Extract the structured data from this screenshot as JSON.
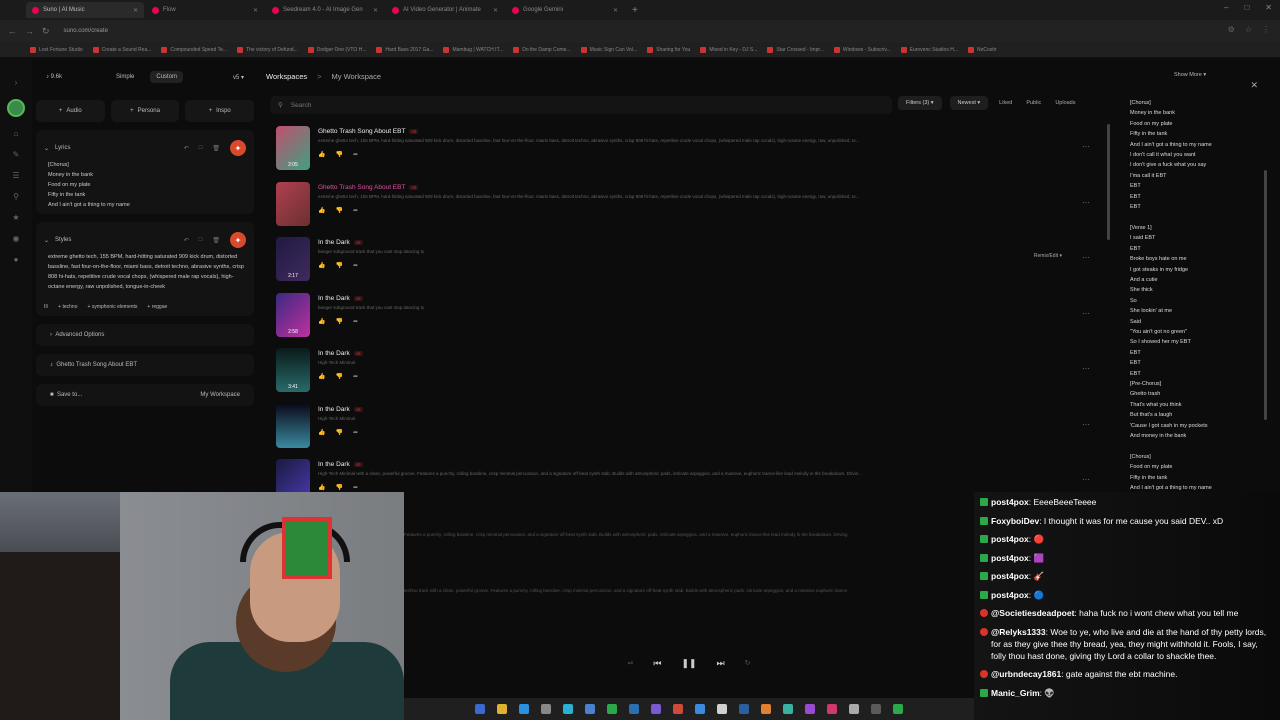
{
  "browser": {
    "tabs": [
      {
        "label": "Suno | AI Music",
        "active": true
      },
      {
        "label": "Flow",
        "active": false
      },
      {
        "label": "Seedream 4.0 - AI Image Gen",
        "active": false
      },
      {
        "label": "AI Video Generator | Animate",
        "active": false
      },
      {
        "label": "Google Gemini",
        "active": false
      }
    ],
    "url": "suno.com/create",
    "bookmarks": [
      "Lost Fortune Studio",
      "Create a Sound Rea...",
      "Compounded Speed Te...",
      "The victory of Defund...",
      "Dodger One (VTO H...",
      "Hard Bass 2017 Ga...",
      "Mambug | WATCH IT...",
      "Do the Damp Come...",
      "Music Sign Can Vol...",
      "Sharing for You",
      "Mixed in Key - DJ S...",
      "Star Crossed - Impr...",
      "Windows - Subscriv...",
      "Eurovenc Studios H...",
      "NoCostir"
    ]
  },
  "left": {
    "credits": "9.6k",
    "modes": [
      "Simple",
      "Custom"
    ],
    "version": "v5",
    "buttons": [
      "Audio",
      "Persona",
      "Inspo"
    ],
    "lyrics_label": "Lyrics",
    "lyrics": "[Chorus]\nMoney in the bank\nFood on my plate\nFifty in the tank\nAnd I ain't got a thing to my name",
    "styles_label": "Styles",
    "styles": "extreme ghetto tech, 155 BPM, hard-hitting saturated 909 kick drum, distorted bassline, fast four-on-the-floor, miami bass, detroit techno, abrasive synths, crisp 808 hi-hats, repetitive crude vocal chops, (whispered male rap vocals), high-octane energy, raw unpolished, tongue-in-cheek",
    "chips": [
      "techno",
      "symphonic elements",
      "reggae"
    ],
    "advanced": "Advanced Options",
    "song_title": "Ghetto Trash Song About EBT",
    "save_to": "Save to...",
    "workspace_btn": "My Workspace"
  },
  "workspace": {
    "root": "Workspaces",
    "current": "My Workspace",
    "search_placeholder": "Search",
    "filters": "Filters (3)",
    "sort": "Newest",
    "tabs": [
      "Liked",
      "Public",
      "Uploads"
    ],
    "remix": "Remix/Edit",
    "songs": [
      {
        "title": "Ghetto Trash Song About EBT",
        "ver": "v5",
        "desc": "extreme ghetto tech, 155 BPM, hard-hitting saturated 909 kick drum, distorted bassline, fast four-on-the-floor, miami bass, detroit techno, abrasive synths, crisp 808 hi-hats, repetitive crude vocal chops, (whispered male rap vocals), high-octane energy, raw, unpolished, to...",
        "dur": "2:05",
        "pink": false
      },
      {
        "title": "Ghetto Trash Song About EBT",
        "ver": "v5",
        "desc": "extreme ghetto tech, 155 BPM, hard-hitting saturated 909 kick drum, distorted bassline, fast four-on-the-floor, miami bass, detroit techno, abrasive synths, crisp 808 hi-hats, repetitive crude vocal chops, (whispered male rap vocals), high-octane energy, raw, unpolished, to...",
        "dur": "",
        "pink": true
      },
      {
        "title": "In the Dark",
        "ver": "v5",
        "desc": "banger subground track that you cant stop dancing to",
        "dur": "2:17",
        "pink": false
      },
      {
        "title": "In the Dark",
        "ver": "v5",
        "desc": "banger subground track that you cant stop dancing to",
        "dur": "2:58",
        "pink": false
      },
      {
        "title": "In the Dark",
        "ver": "v5",
        "desc": "High-Tech Minimal",
        "dur": "3:41",
        "pink": false
      },
      {
        "title": "In the Dark",
        "ver": "v5",
        "desc": "High-Tech Minimal",
        "dur": "",
        "pink": false
      },
      {
        "title": "In the Dark",
        "ver": "v5",
        "desc": "High-Tech Minimal with a clean, powerful groove. Features a punchy, rolling bassline, crisp minimal percussion, and a signature off-beat synth stab. Builds with atmospheric pads, intricate arpeggios, and a massive, euphoric trance-like lead melody in the breakdown. Drivin...",
        "dur": "",
        "pink": false
      }
    ],
    "hidden_descs": [
      "Features a punchy, rolling bassline, crisp minimal percussion, and a signature off-beat synth stab. Builds with atmospheric pads, intricate arpeggios, and a massive, euphoric trance-like lead melody in the breakdown. Driving",
      "techno track with a clean, powerful groove. Features a punchy, rolling bassline, crisp minimal percussion, and a signature off-beat synth stab. Builds with atmospheric pads, intricate arpeggios, and a massive euphoric trance"
    ]
  },
  "right": {
    "show_more": "Show More",
    "lyrics": "[Chorus]\nMoney in the bank\nFood on my plate\nFifty in the tank\nAnd I ain't got a thing to my name\nI don't call it what you want\nI don't give a fuck what you say\nI'ma call it EBT\nEBT\nEBT\nEBT\n\n[Verse 1]\nI said EBT\nEBT\nBroke boys hate on me\nI got steaks in my fridge\nAnd a cutie\nShe thick\nSo\nShe lookin' at me\nSaid\n\"You ain't got no green\"\nSo I showed her my EBT\nEBT\nEBT\nEBT\n[Pre-Chorus]\nGhetto trash\nThat's what you think\nBut that's a laugh\n'Cause I got cash in my pockets\nAnd money in the bank\n\n[Chorus]\nFood on my plate\nFifty in the tank\nAnd I ain't got a thing to my name"
  },
  "chat": [
    {
      "user": "post4pox",
      "text": "EeeeBeeeTeeee",
      "badge": "green"
    },
    {
      "user": "FoxyboiDev",
      "text": "I thought it was for me cause you said DEV.. xD",
      "badge": "green"
    },
    {
      "user": "post4pox",
      "text": "🔴",
      "badge": "green"
    },
    {
      "user": "post4pox",
      "text": "🟪",
      "badge": "green"
    },
    {
      "user": "post4pox",
      "text": "🎸",
      "badge": "green"
    },
    {
      "user": "post4pox",
      "text": "🔵",
      "badge": "green"
    },
    {
      "user": "@Societiesdeadpoet",
      "text": "haha fuck no i wont chew what you tell me",
      "badge": "red"
    },
    {
      "user": "@Relyks1333",
      "text": "Woe to ye, who live and die at the hand of thy petty lords, for as they give thee thy bread, yea, they might withhold it. Fools, I say, folly thou hast done, giving thy Lord a collar to shackle thee.",
      "badge": "red"
    },
    {
      "user": "@urbndecay1861",
      "text": "gate against the ebt machine.",
      "badge": "red"
    },
    {
      "user": "Manic_Grim",
      "text": "👽",
      "badge": "green"
    }
  ]
}
